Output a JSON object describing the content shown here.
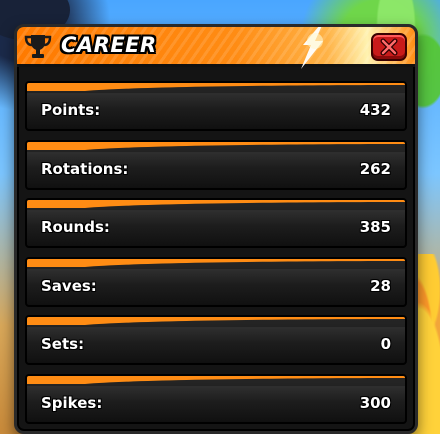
{
  "header": {
    "title": "CAREER"
  },
  "icons": {
    "trophy": "trophy-icon",
    "sparkle": "sparkle-icon",
    "close": "close-icon"
  },
  "colors": {
    "header_orange": "#ff7a00",
    "row_accent": "#ff8c14",
    "close_red": "#c81a1a",
    "panel_bg": "#141414"
  },
  "stats": [
    {
      "label": "Points:",
      "value": "432"
    },
    {
      "label": "Rotations:",
      "value": "262"
    },
    {
      "label": "Rounds:",
      "value": "385"
    },
    {
      "label": "Saves:",
      "value": "28"
    },
    {
      "label": "Sets:",
      "value": "0"
    },
    {
      "label": "Spikes:",
      "value": "300"
    }
  ]
}
